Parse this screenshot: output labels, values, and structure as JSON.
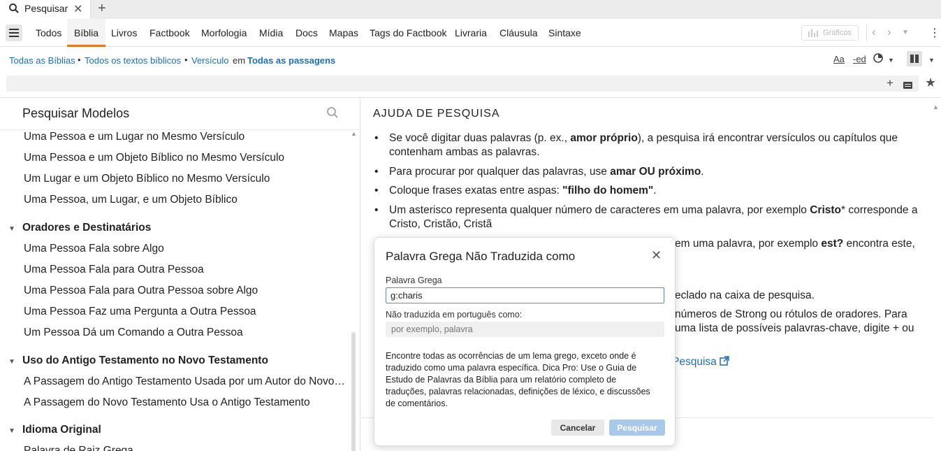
{
  "tab": {
    "label": "Pesquisar",
    "icon": "search-icon"
  },
  "nav": {
    "tabs": [
      "Todos",
      "Bíblia",
      "Livros",
      "Factbook",
      "Morfologia",
      "Mídia",
      "Docs",
      "Mapas",
      "Tags do Factbook",
      "Livraria",
      "Cláusula",
      "Sintaxe"
    ],
    "active_tab": "Bíblia",
    "graficos_label": "Gráficos"
  },
  "scope": {
    "bibles": "Todas as Bíblias",
    "texts": "Todos os textos bíblicos",
    "unit": "Versículo",
    "connector": "em",
    "passages": "Todas as passagens",
    "tool_aa": "Aa",
    "tool_ed": "-ed"
  },
  "left": {
    "title": "Pesquisar Modelos",
    "items_a": [
      "Uma Pessoa e um Lugar no Mesmo Versículo",
      "Uma Pessoa e um Objeto Bíblico no Mesmo Versículo",
      "Um Lugar e um Objeto Bíblico no Mesmo Versículo",
      "Uma Pessoa, um Lugar, e um Objeto Bíblico"
    ],
    "group_b": "Oradores e Destinatários",
    "items_b": [
      "Uma Pessoa Fala sobre Algo",
      "Uma Pessoa Fala para Outra Pessoa",
      "Uma Pessoa Fala para Outra Pessoa sobre Algo",
      "Uma Pessoa Faz uma Pergunta a Outra Pessoa",
      "Um Pessoa Dá um Comando a Outra Pessoa"
    ],
    "group_c": "Uso do Antigo Testamento no Novo Testamento",
    "items_c": [
      "A Passagem do Antigo Testamento Usada por um Autor do Novo Testamento",
      "A Passagem do Novo Testamento Usa o Antigo Testamento"
    ],
    "group_d": "Idioma Original",
    "items_d": [
      "Palavra de Raiz Grega"
    ]
  },
  "help": {
    "title": "AJUDA DE PESQUISA",
    "b1_pre": "Se você digitar duas palavras (p. ex., ",
    "b1_bold": "amor próprio",
    "b1_post": "), a pesquisa irá encontrar versículos ou capítulos que contenham ambas as palavras.",
    "b2_pre": "Para procurar por qualquer das palavras, use ",
    "b2_bold": "amar OU próximo",
    "b2_post": ".",
    "b3_pre": "Coloque frases exatas entre aspas: ",
    "b3_bold": "\"filho do homem\"",
    "b3_post": ".",
    "b4_pre": "Um asterisco representa qualquer número de caracteres em uma palavra, por exemplo ",
    "b4_bold": "Cristo",
    "b4_post": "* corresponde a Cristo, Cristão, Cristã",
    "b5_pre": "em uma palavra, por exemplo ",
    "b5_bold": "est?",
    "b5_post": " encontra este,",
    "b6": "eclado na caixa de pesquisa.",
    "b7a": "números de Strong ou rótulos de oradores. Para",
    "b7b": "uma lista de possíveis palavras-chave, digite + ou",
    "link": "Pesquisa"
  },
  "dialog": {
    "title": "Palavra Grega Não Traduzida como",
    "greek_label": "Palavra Grega",
    "greek_value": "g:charis",
    "port_label": "Não traduzida em português como:",
    "port_placeholder": "por exemplo, palavra",
    "description": "Encontre todas as ocorrências de um lema grego, exceto onde é traduzido como uma palavra específica. Dica Pro: Use o Guia de Estudo de Palavras da Bíblia para um relatório completo de traduções, palavras relacionadas, definições de léxico, e discussões de comentários.",
    "cancel": "Cancelar",
    "search": "Pesquisar"
  },
  "colors": {
    "accent": "#e8731d",
    "link": "#1f6fb5",
    "primary_disabled": "#a9c8ea"
  }
}
